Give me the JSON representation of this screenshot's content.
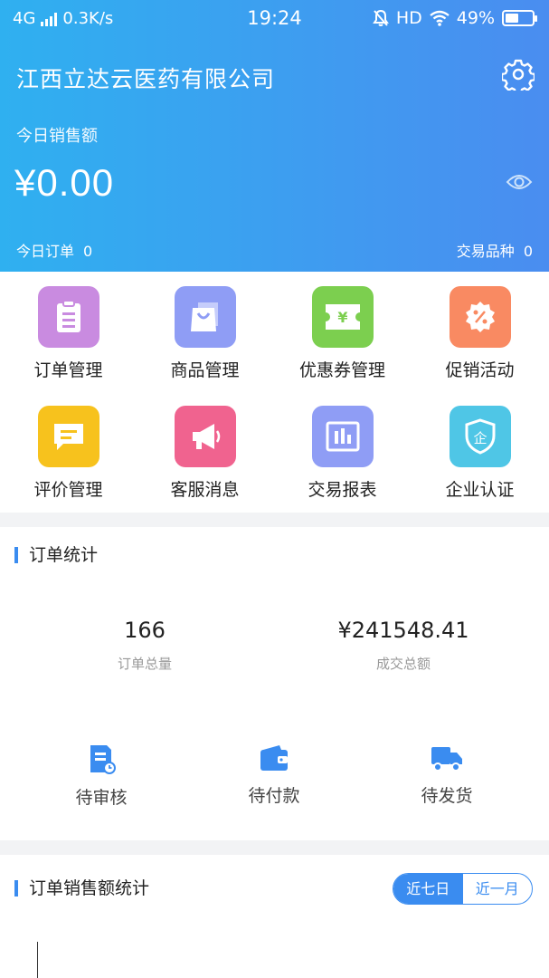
{
  "status_bar": {
    "network": "4G",
    "speed": "0.3K/s",
    "time": "19:24",
    "hd": "HD",
    "battery": "49%",
    "battery_level": 0.49
  },
  "header": {
    "company": "江西立达云医药有限公司",
    "sales_label": "今日销售额",
    "sales_value": "¥0.00",
    "orders_today_label": "今日订单",
    "orders_today_value": "0",
    "trade_kinds_label": "交易品种",
    "trade_kinds_value": "0"
  },
  "menu": [
    {
      "label": "订单管理",
      "icon": "clipboard-icon",
      "color": "#c98be0"
    },
    {
      "label": "商品管理",
      "icon": "shopping-bag-icon",
      "color": "#8f9df5"
    },
    {
      "label": "优惠券管理",
      "icon": "coupon-icon",
      "color": "#7ccf4f"
    },
    {
      "label": "促销活动",
      "icon": "discount-badge-icon",
      "color": "#f98a62"
    },
    {
      "label": "评价管理",
      "icon": "comment-icon",
      "color": "#f7c21d"
    },
    {
      "label": "客服消息",
      "icon": "megaphone-icon",
      "color": "#f0638f"
    },
    {
      "label": "交易报表",
      "icon": "report-chart-icon",
      "color": "#8f9df5"
    },
    {
      "label": "企业认证",
      "icon": "shield-certified-icon",
      "color": "#4fc6e6"
    }
  ],
  "order_stats": {
    "title": "订单统计",
    "total_orders_value": "166",
    "total_orders_label": "订单总量",
    "total_amount_value": "¥241548.41",
    "total_amount_label": "成交总额",
    "statuses": [
      {
        "label": "待审核",
        "icon": "review-doc-icon"
      },
      {
        "label": "待付款",
        "icon": "wallet-icon"
      },
      {
        "label": "待发货",
        "icon": "truck-icon"
      }
    ]
  },
  "sales_stats": {
    "title": "订单销售额统计",
    "tab_week": "近七日",
    "tab_month": "近一月",
    "active_tab": "近七日"
  },
  "colors": {
    "header_start": "#2fb0f0",
    "header_end": "#4a8df0",
    "accent": "#3a8cf0"
  }
}
